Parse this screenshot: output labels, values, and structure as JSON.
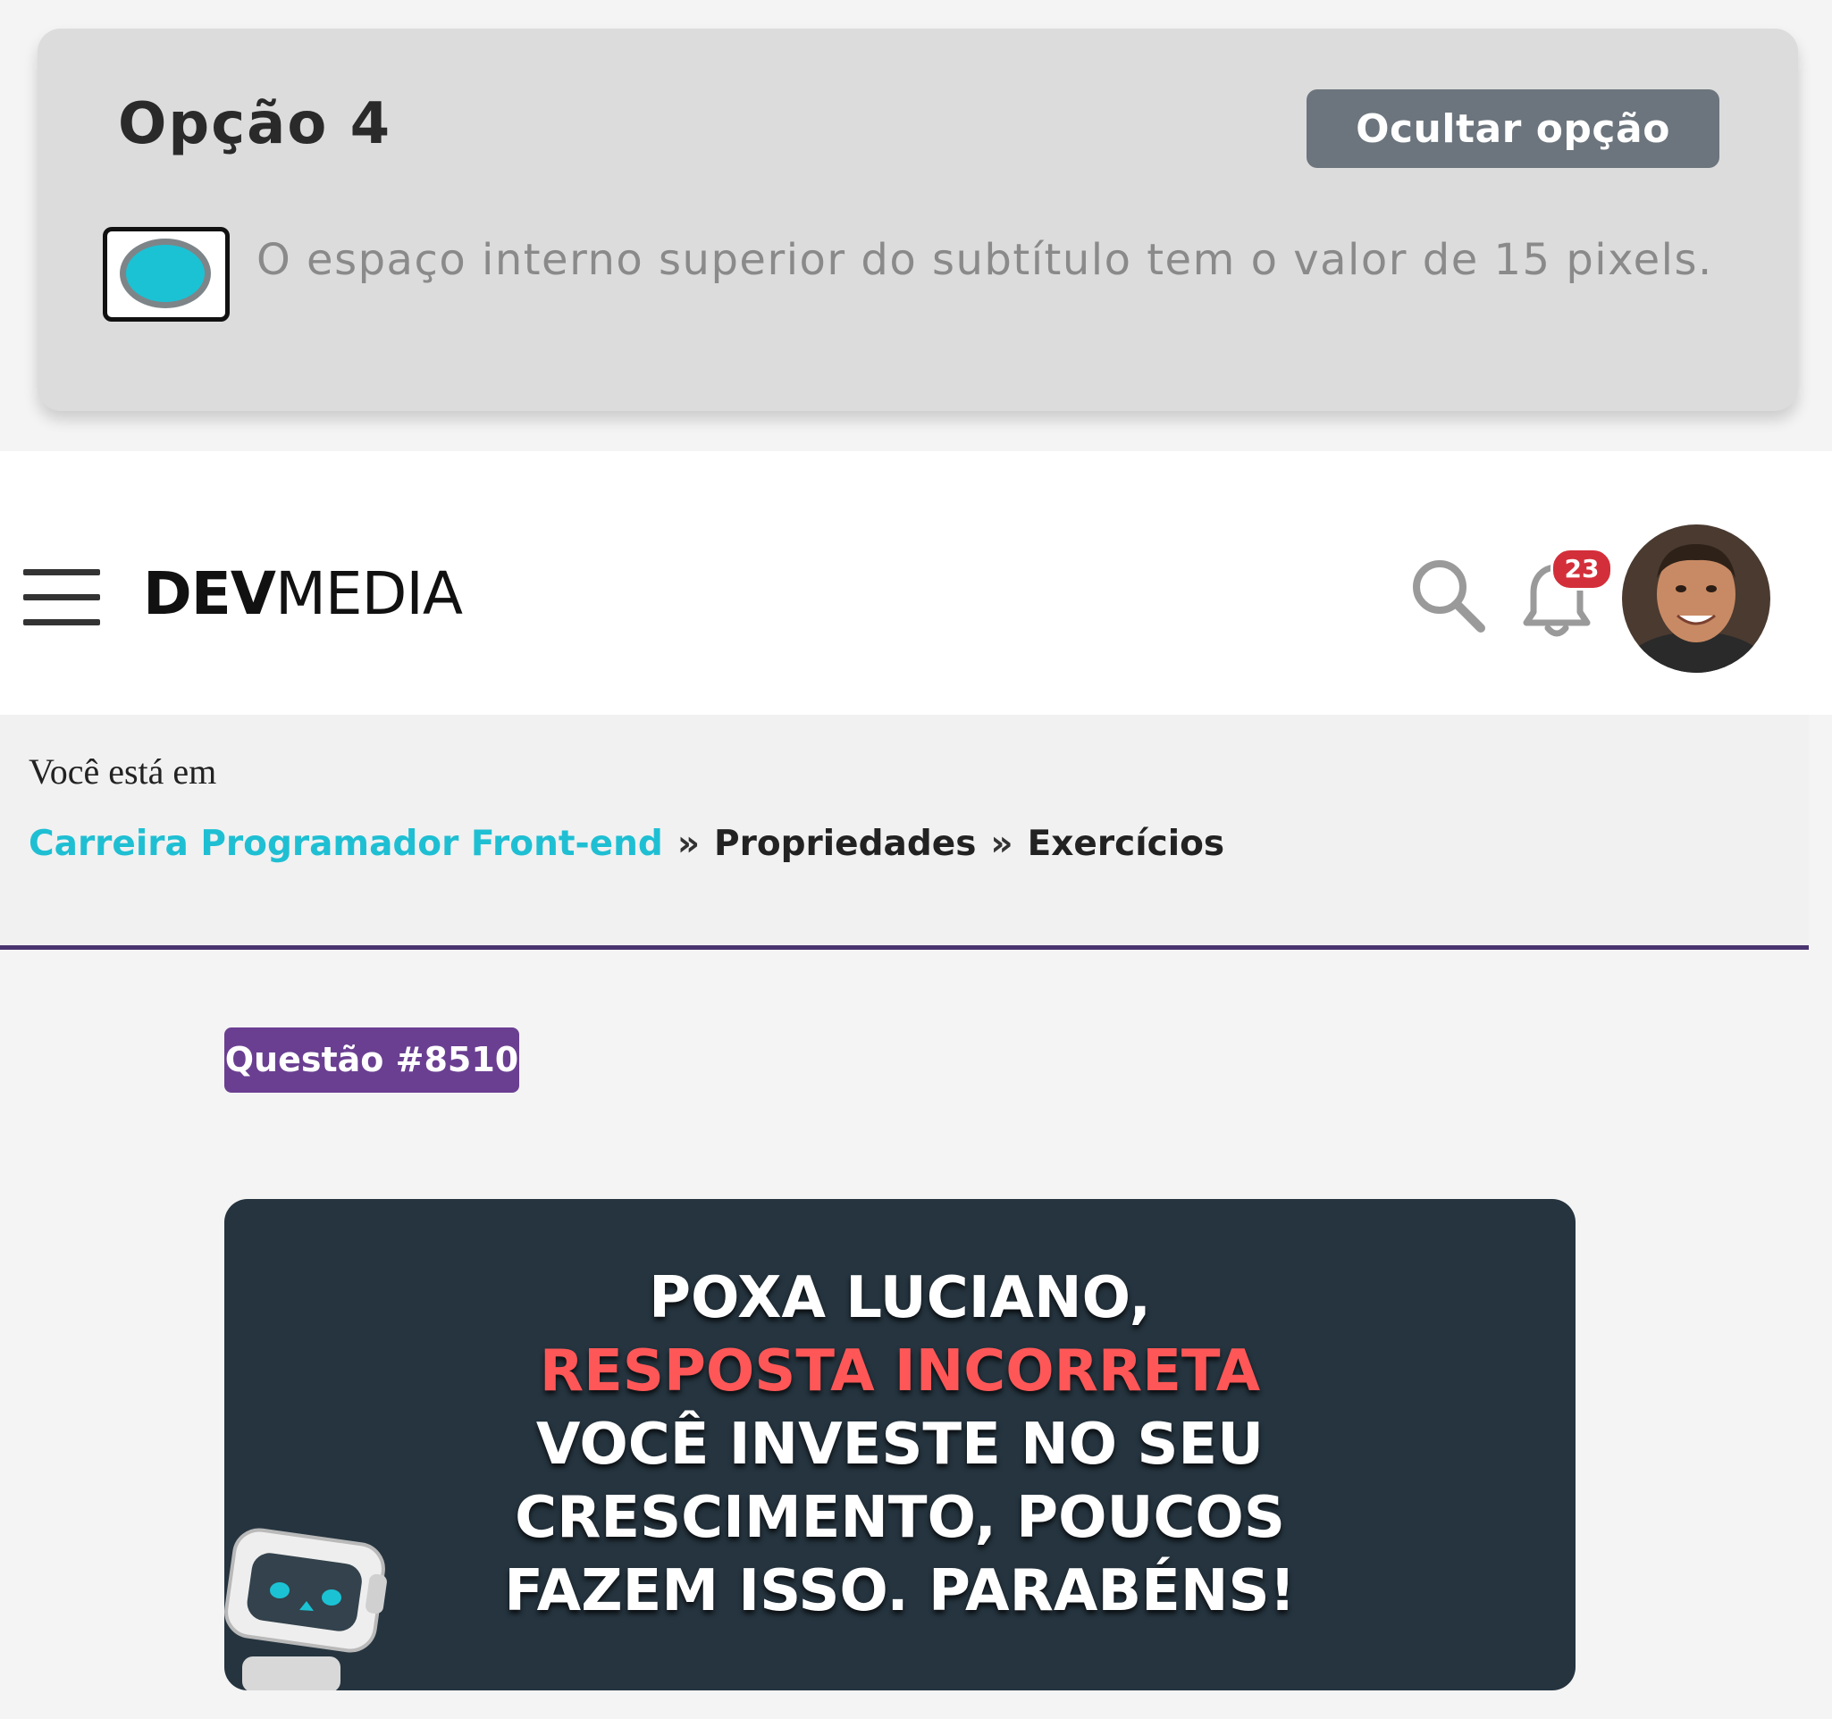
{
  "option": {
    "title": "Opção 4",
    "hide_label": "Ocultar opção",
    "text": "O espaço interno superior do subtítulo tem o valor de 15 pixels.",
    "selected": true
  },
  "header": {
    "logo_bold": "DEV",
    "logo_light": "MEDIA",
    "notification_count": "23"
  },
  "breadcrumb": {
    "intro": "Você está em",
    "separator": "»",
    "items": [
      "Carreira Programador Front-end",
      "Propriedades",
      "Exercícios"
    ]
  },
  "question": {
    "badge": "Questão #8510"
  },
  "feedback": {
    "line1": "POXA LUCIANO,",
    "line2": "RESPOSTA INCORRETA",
    "line3": "VOCÊ INVESTE NO SEU",
    "line4": "CRESCIMENTO, POUCOS",
    "line5": "FAZEM ISSO. PARABÉNS!"
  },
  "colors": {
    "accent_cyan": "#1fbfd3",
    "brand_purple": "#6a3f91",
    "error_red": "#ff5757",
    "banner_bg": "#25343f",
    "badge_red": "#d32f3a"
  },
  "icons": {
    "menu": "hamburger-icon",
    "search": "search-icon",
    "notifications": "bell-icon",
    "radio": "radio-selected-icon"
  }
}
